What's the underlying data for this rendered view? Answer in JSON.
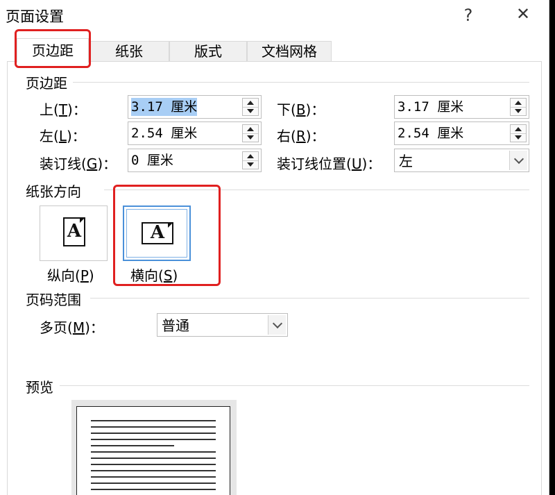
{
  "title": "页面设置",
  "title_bar": {
    "help": "?",
    "close": "✕"
  },
  "tabs": [
    {
      "label": "页边距",
      "active": true
    },
    {
      "label": "纸张",
      "active": false
    },
    {
      "label": "版式",
      "active": false
    },
    {
      "label": "文档网格",
      "active": false
    }
  ],
  "margins": {
    "section_title": "页边距",
    "top": {
      "label_pre": "上(",
      "key": "T",
      "label_post": ")：",
      "value": "3.17 厘米"
    },
    "bottom": {
      "label_pre": "下(",
      "key": "B",
      "label_post": ")：",
      "value": "3.17 厘米"
    },
    "left": {
      "label_pre": "左(",
      "key": "L",
      "label_post": ")：",
      "value": "2.54 厘米"
    },
    "right": {
      "label_pre": "右(",
      "key": "R",
      "label_post": ")：",
      "value": "2.54 厘米"
    },
    "gutter": {
      "label_pre": "装订线(",
      "key": "G",
      "label_post": ")：",
      "value": "0 厘米"
    },
    "gutter_pos": {
      "label_pre": "装订线位置(",
      "key": "U",
      "label_post": ")：",
      "value": "左"
    }
  },
  "orientation": {
    "section_title": "纸张方向",
    "portrait": {
      "label_pre": "纵向(",
      "key": "P",
      "label_post": ")",
      "icon_letter": "A"
    },
    "landscape": {
      "label_pre": "横向(",
      "key": "S",
      "label_post": ")",
      "icon_letter": "A",
      "selected": true
    }
  },
  "pages": {
    "section_title": "页码范围",
    "multiple": {
      "label_pre": "多页(",
      "key": "M",
      "label_post": ")：",
      "value": "普通"
    }
  },
  "preview": {
    "section_title": "预览"
  },
  "colors": {
    "highlight_red": "#e02020",
    "selection_blue": "#a8cef5",
    "focus_blue": "#4a90d9"
  }
}
